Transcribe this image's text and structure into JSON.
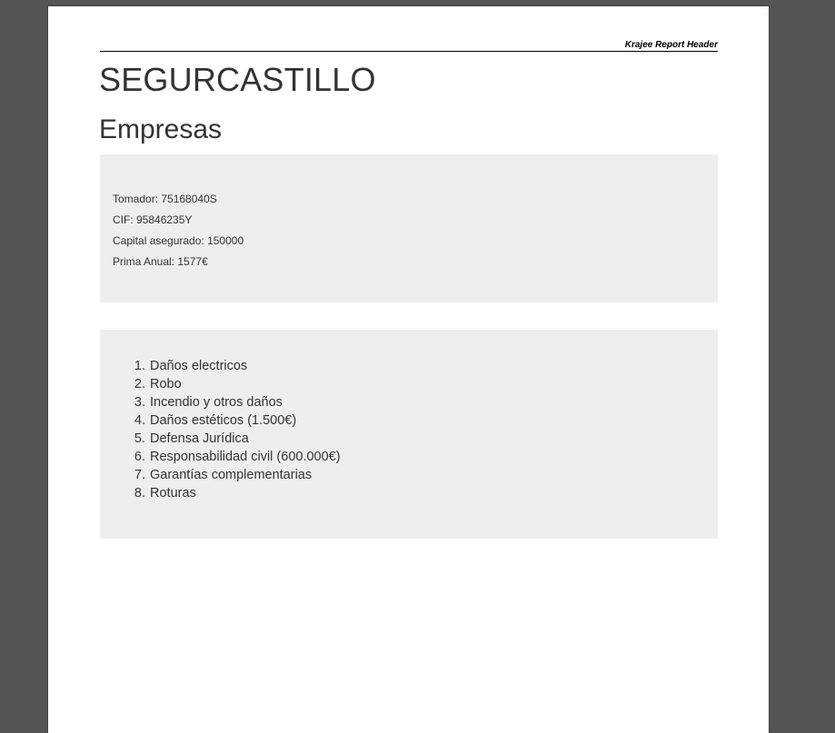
{
  "report": {
    "header": "Krajee Report Header",
    "company": "SEGURCASTILLO",
    "section": "Empresas"
  },
  "policy": {
    "tomador": "Tomador: 75168040S",
    "cif": "CIF: 95846235Y",
    "capital": "Capital asegurado: 150000",
    "prima": "Prima Anual: 1577€"
  },
  "coverages": [
    "Daños electricos",
    "Robo",
    "Incendio y otros daños",
    "Daños estéticos (1.500€)",
    "Defensa Jurídica",
    "Responsabilidad civil (600.000€)",
    "Garantías complementarias",
    "Roturas"
  ],
  "colors": {
    "viewer_background": "#525659",
    "page": "#ffffff",
    "panel": "#eeeeee",
    "text": "#333333"
  }
}
